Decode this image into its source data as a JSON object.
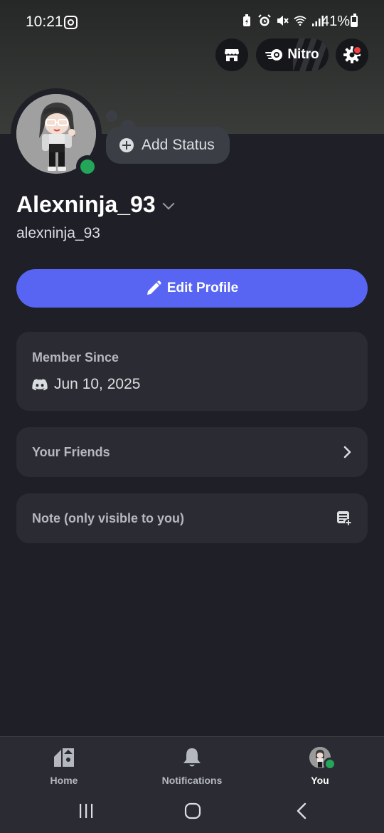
{
  "status_bar": {
    "time": "10:21",
    "battery_text": "41%",
    "battery_level": 0.41,
    "icons": [
      "instagram-icon",
      "battery-saver-icon",
      "alarm-icon",
      "mute-icon",
      "wifi-icon",
      "signal-icon",
      "battery-icon"
    ]
  },
  "top_actions": {
    "shop_icon": "shop-icon",
    "nitro_label": "Nitro",
    "settings_icon": "gear-icon",
    "settings_has_notification": true
  },
  "profile": {
    "display_name": "Alexninja_93",
    "username": "alexninja_93",
    "online_status": "online",
    "add_status_label": "Add Status"
  },
  "edit_profile_label": "Edit Profile",
  "cards": {
    "member_since": {
      "heading": "Member Since",
      "date": "Jun 10, 2025"
    },
    "friends": {
      "label": "Your Friends"
    },
    "note": {
      "placeholder": "Note (only visible to you)"
    }
  },
  "bottom_nav": {
    "tabs": [
      {
        "label": "Home",
        "icon": "home-icon",
        "active": false
      },
      {
        "label": "Notifications",
        "icon": "bell-icon",
        "active": false
      },
      {
        "label": "You",
        "icon": "avatar",
        "active": true
      }
    ]
  },
  "system_nav": [
    "recents-button",
    "home-button",
    "back-button"
  ],
  "colors": {
    "background": "#1f2027",
    "card": "#2b2c33",
    "blurple": "#5865f2",
    "online": "#23a55a",
    "notification_red": "#f23f43"
  }
}
